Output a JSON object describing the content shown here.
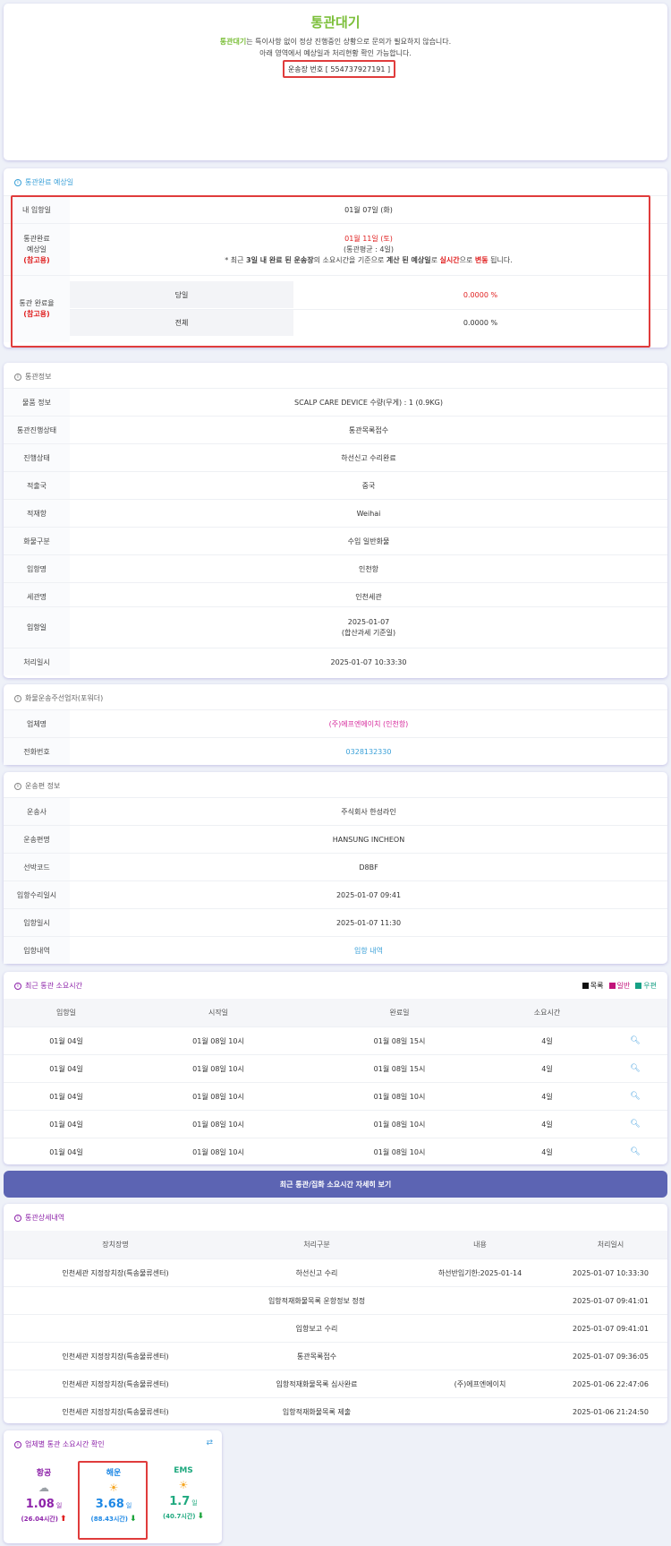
{
  "header": {
    "title": "통관대기",
    "desc_highlight": "통관대기",
    "desc_rest": "는 특이사항 없이 정상 진행중인 상황으로 문의가 필요하지 않습니다.",
    "desc_line2": "아래 영역에서 예상일과 처리현황 확인 가능합니다.",
    "waybill": "운송장 번호 [ 554737927191 ]"
  },
  "eta": {
    "title": "통관완료 예상일",
    "arrival_label": "내 입항일",
    "arrival_value": "01월 07일 (화)",
    "expected_label1": "통관완료",
    "expected_label2": "예상일",
    "expected_label3": "(참고용)",
    "expected_date": "01월 11일 (토)",
    "expected_avg": "(통관평균 : 4일)",
    "note_pre": "* 최근 ",
    "note_b1": "3일 내 완료 된 운송장",
    "note_mid": "의 소요시간을 기준으로 ",
    "note_b2": "계산 된 예상일",
    "note_mid2": "로 ",
    "note_r1": "실시간",
    "note_mid3": "으로 ",
    "note_r2": "변동",
    "note_end": " 됩니다.",
    "rate_label1": "통관 완료율",
    "rate_label2": "(참고용)",
    "today_label": "당일",
    "today_value": "0.0000 %",
    "total_label": "전체",
    "total_value": "0.0000 %"
  },
  "customs_info": {
    "title": "통관정보",
    "rows": [
      {
        "label": "물품 정보",
        "value": "SCALP CARE DEVICE 수량(무게) : 1 (0.9KG)"
      },
      {
        "label": "통관진행상태",
        "value": "통관목록접수"
      },
      {
        "label": "진행상태",
        "value": "하선신고 수리완료"
      },
      {
        "label": "적출국",
        "value": "중국"
      },
      {
        "label": "적재항",
        "value": "Weihai"
      },
      {
        "label": "화물구분",
        "value": "수입 일반화물"
      },
      {
        "label": "입항명",
        "value": "인천항"
      },
      {
        "label": "세관명",
        "value": "인천세관"
      }
    ],
    "arrival_label": "입항일",
    "arrival_value1": "2025-01-07",
    "arrival_value2": "(합산과세 기준일)",
    "processed_label": "처리일시",
    "processed_value": "2025-01-07 10:33:30"
  },
  "forwarder": {
    "title": "화물운송주선업자(포워더)",
    "company_label": "업체명",
    "company_value": "(주)에프엔에이치 (인천항)",
    "phone_label": "전화번호",
    "phone_value": "0328132330"
  },
  "vessel": {
    "title": "운송편 정보",
    "rows": [
      {
        "label": "운송사",
        "value": "주식회사 한성라인"
      },
      {
        "label": "운송편명",
        "value": "HANSUNG INCHEON"
      },
      {
        "label": "선박코드",
        "value": "D8BF"
      },
      {
        "label": "입항수리일시",
        "value": "2025-01-07 09:41"
      },
      {
        "label": "입항일시",
        "value": "2025-01-07 11:30"
      }
    ],
    "history_label": "입항내역",
    "history_link": "입항 내역"
  },
  "recent": {
    "title": "최근 통관 소요시간",
    "legend": [
      {
        "label": "목록",
        "color": "#111111"
      },
      {
        "label": "일반",
        "color": "#c2127a"
      },
      {
        "label": "우편",
        "color": "#16a085"
      }
    ],
    "headers": [
      "입항일",
      "시작일",
      "완료일",
      "소요시간"
    ],
    "rows": [
      [
        "01월 04일",
        "01월 08일 10시",
        "01월 08일 15시",
        "4일"
      ],
      [
        "01월 04일",
        "01월 08일 10시",
        "01월 08일 15시",
        "4일"
      ],
      [
        "01월 04일",
        "01월 08일 10시",
        "01월 08일 10시",
        "4일"
      ],
      [
        "01월 04일",
        "01월 08일 10시",
        "01월 08일 10시",
        "4일"
      ],
      [
        "01월 04일",
        "01월 08일 10시",
        "01월 08일 10시",
        "4일"
      ]
    ],
    "button": "최근 통관/집화 소요시간 자세히 보기"
  },
  "details": {
    "title": "통관상세내역",
    "headers": [
      "장치장명",
      "처리구분",
      "내용",
      "처리일시"
    ],
    "rows": [
      [
        "인천세관 지정장치장(특송물류센터)",
        "하선신고 수리",
        "하선반입기한:2025-01-14",
        "2025-01-07 10:33:30"
      ],
      [
        "",
        "입항적재화물목록 운항정보 정정",
        "",
        "2025-01-07 09:41:01"
      ],
      [
        "",
        "입항보고 수리",
        "",
        "2025-01-07 09:41:01"
      ],
      [
        "인천세관 지정장치장(특송물류센터)",
        "통관목록접수",
        "",
        "2025-01-07 09:36:05"
      ],
      [
        "인천세관 지정장치장(특송물류센터)",
        "입항적재화물목록 심사완료",
        "(주)에프엔에이치",
        "2025-01-06 22:47:06"
      ],
      [
        "인천세관 지정장치장(특송물류센터)",
        "입항적재화물목록 제출",
        "",
        "2025-01-06 21:24:50"
      ]
    ]
  },
  "carrier": {
    "title": "업체별 통관 소요시간 확인",
    "items": [
      {
        "name": "항공",
        "weather": "cloud-icon",
        "days": "1.08",
        "unit": "일",
        "sub": "(26.04시간)",
        "trend": "up",
        "color": "#8e24aa"
      },
      {
        "name": "해운",
        "weather": "sun-icon",
        "days": "3.68",
        "unit": "일",
        "sub": "(88.43시간)",
        "trend": "down",
        "color": "#1e88e5"
      },
      {
        "name": "EMS",
        "weather": "sun-icon",
        "days": "1.7",
        "unit": "일",
        "sub": "(40.7시간)",
        "trend": "down",
        "color": "#1fa97f"
      }
    ]
  }
}
